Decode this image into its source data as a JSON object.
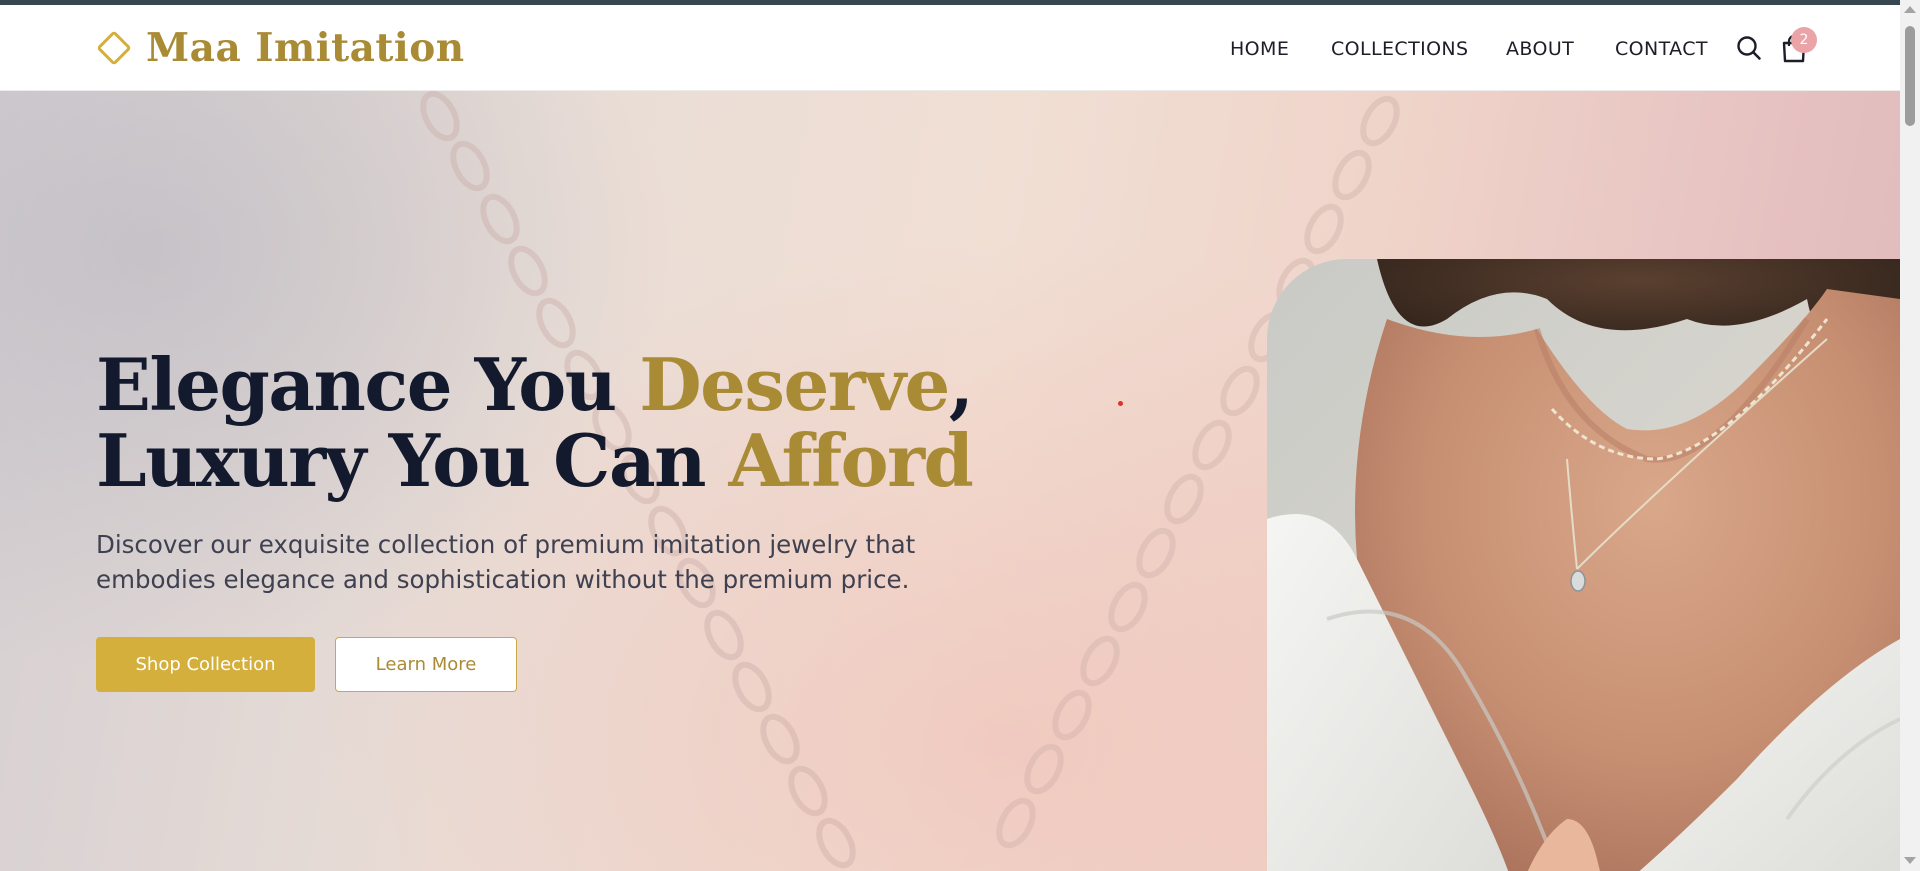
{
  "brand": {
    "name": "Maa Imitation",
    "color": "#a98a35",
    "icon": "diamond-logo-icon"
  },
  "nav": {
    "items": [
      {
        "label": "HOME"
      },
      {
        "label": "COLLECTIONS"
      },
      {
        "label": "ABOUT"
      },
      {
        "label": "CONTACT"
      }
    ],
    "search_icon": "search-icon",
    "cart_icon": "shopping-bag-icon",
    "cart_count": "2"
  },
  "hero": {
    "title_line1_part1": "Elegance You ",
    "title_line1_accent": "Deserve",
    "title_line1_end": ",",
    "title_line2_part1": "Luxury You Can ",
    "title_line2_accent": "Afford",
    "description_line1": "Discover our exquisite collection of premium imitation jewelry that",
    "description_line2": "embodies elegance and sophistication without the premium price.",
    "primary_button": "Shop Collection",
    "secondary_button": "Learn More",
    "image": "woman-wearing-gold-necklaces-photo"
  },
  "colors": {
    "accent": "#a98a35",
    "primary_button": "#d4af3c",
    "title": "#141a2e",
    "badge": "#eaa3a6"
  }
}
